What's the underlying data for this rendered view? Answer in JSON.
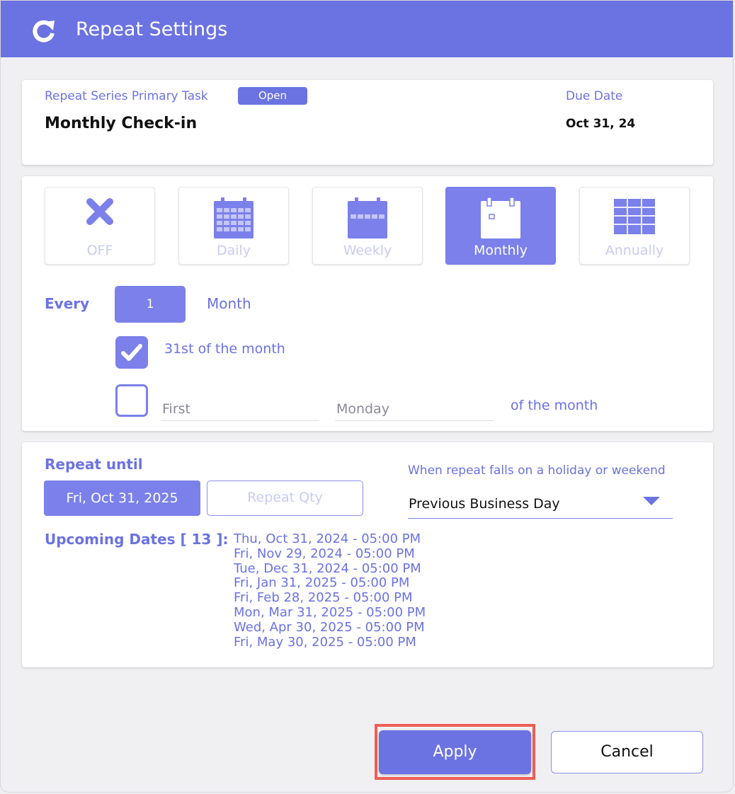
{
  "dialog": {
    "title": "Repeat Settings",
    "icon": "refresh-icon",
    "accent_color": "#6b72e2",
    "highlight_color": "#ee5e55"
  },
  "task": {
    "label": "Repeat Series Primary Task",
    "status": "Open",
    "name": "Monthly Check-in",
    "due_label": "Due Date",
    "due_value": "Oct 31, 24"
  },
  "frequency": {
    "options": [
      {
        "label": "OFF",
        "icon": "close-icon"
      },
      {
        "label": "Daily",
        "icon": "calendar-daily-icon"
      },
      {
        "label": "Weekly",
        "icon": "calendar-weekly-icon"
      },
      {
        "label": "Monthly",
        "icon": "calendar-monthly-icon"
      },
      {
        "label": "Annually",
        "icon": "calendar-annually-icon"
      }
    ],
    "selected": "Monthly"
  },
  "interval": {
    "label": "Every",
    "value": "1",
    "unit": "Month"
  },
  "monthly_options": {
    "day_option": {
      "checked": true,
      "label": "31st of the month"
    },
    "weekday_option": {
      "checked": false,
      "ordinal_placeholder": "First",
      "weekday_placeholder": "Monday",
      "suffix": "of the month"
    }
  },
  "repeat_until": {
    "label": "Repeat until",
    "date_button": "Fri, Oct 31, 2025",
    "qty_button": "Repeat Qty"
  },
  "holiday": {
    "label": "When repeat falls on a holiday or weekend",
    "value": "Previous Business Day"
  },
  "upcoming": {
    "label": "Upcoming Dates [ 13 ]:",
    "dates": [
      "Thu, Oct 31, 2024 - 05:00 PM",
      "Fri, Nov 29, 2024 - 05:00 PM",
      "Tue, Dec 31, 2024 - 05:00 PM",
      "Fri, Jan 31, 2025 - 05:00 PM",
      "Fri, Feb 28, 2025 - 05:00 PM",
      "Mon, Mar 31, 2025 - 05:00 PM",
      "Wed, Apr 30, 2025 - 05:00 PM",
      "Fri, May 30, 2025 - 05:00 PM"
    ]
  },
  "footer": {
    "apply_label": "Apply",
    "cancel_label": "Cancel"
  }
}
